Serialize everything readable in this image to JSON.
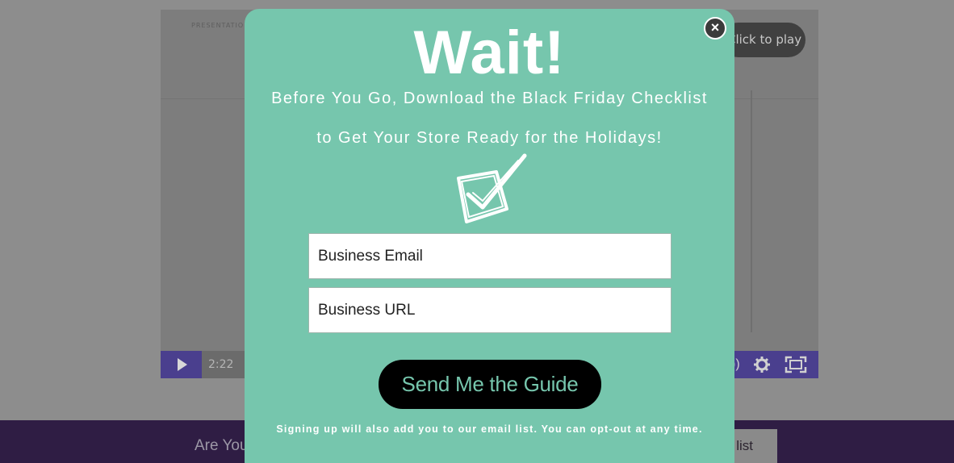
{
  "background": {
    "video": {
      "header_text": "PRESENTATION",
      "click_to_play": "Click to play",
      "time": "2:22"
    },
    "bottom_bar": {
      "text": "Are You",
      "button_label": "list"
    }
  },
  "modal": {
    "title": "Wait!",
    "subtitle_line1": "Before You Go, Download the Black Friday Checklist",
    "subtitle_line2": "to Get Your Store Ready for the Holidays!",
    "email_placeholder": "Business Email",
    "url_placeholder": "Business URL",
    "submit_label": "Send Me the Guide",
    "disclaimer": "Signing up will also add you to our email list. You can opt-out at any time.",
    "close_label": "×"
  },
  "colors": {
    "modal_bg": "#76c6ad",
    "button_bg": "#000000",
    "button_text": "#76c6ad",
    "player_accent": "#4a3f8e",
    "bottom_bar": "#2f1d44"
  }
}
